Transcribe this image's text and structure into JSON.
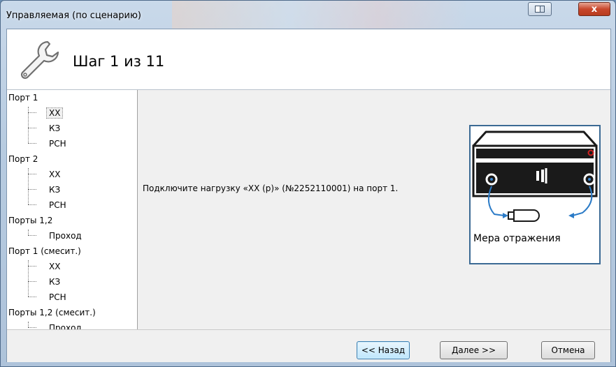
{
  "window": {
    "title": "Управляемая (по сценарию)"
  },
  "titlebar_buttons": {
    "restore_icon": "restore-icon",
    "close_symbol": "x"
  },
  "header": {
    "icon": "wrench-icon",
    "step_title": "Шаг 1 из 11"
  },
  "tree": {
    "groups": [
      {
        "label": "Порт 1",
        "children": [
          "XX",
          "КЗ",
          "РСН"
        ]
      },
      {
        "label": "Порт 2",
        "children": [
          "XX",
          "КЗ",
          "РСН"
        ]
      },
      {
        "label": "Порты 1,2",
        "children": [
          "Проход"
        ]
      },
      {
        "label": "Порт 1 (смесит.)",
        "children": [
          "XX",
          "КЗ",
          "РСН"
        ]
      },
      {
        "label": "Порты 1,2 (смесит.)",
        "children": [
          "Проход"
        ]
      }
    ],
    "selected": "Порт 1 / XX"
  },
  "content": {
    "instruction": "Подключите нагрузку «XX (р)» (№2252110001) на порт 1.",
    "illustration": {
      "icon": "device-illustration",
      "caption": "Мера отражения"
    }
  },
  "footer": {
    "back": "<< Назад",
    "next": "Далее >>",
    "cancel": "Отмена"
  },
  "colors": {
    "accent": "#3b6a94",
    "close_button": "#c8472c",
    "window_frame": "#b7cbe0"
  }
}
